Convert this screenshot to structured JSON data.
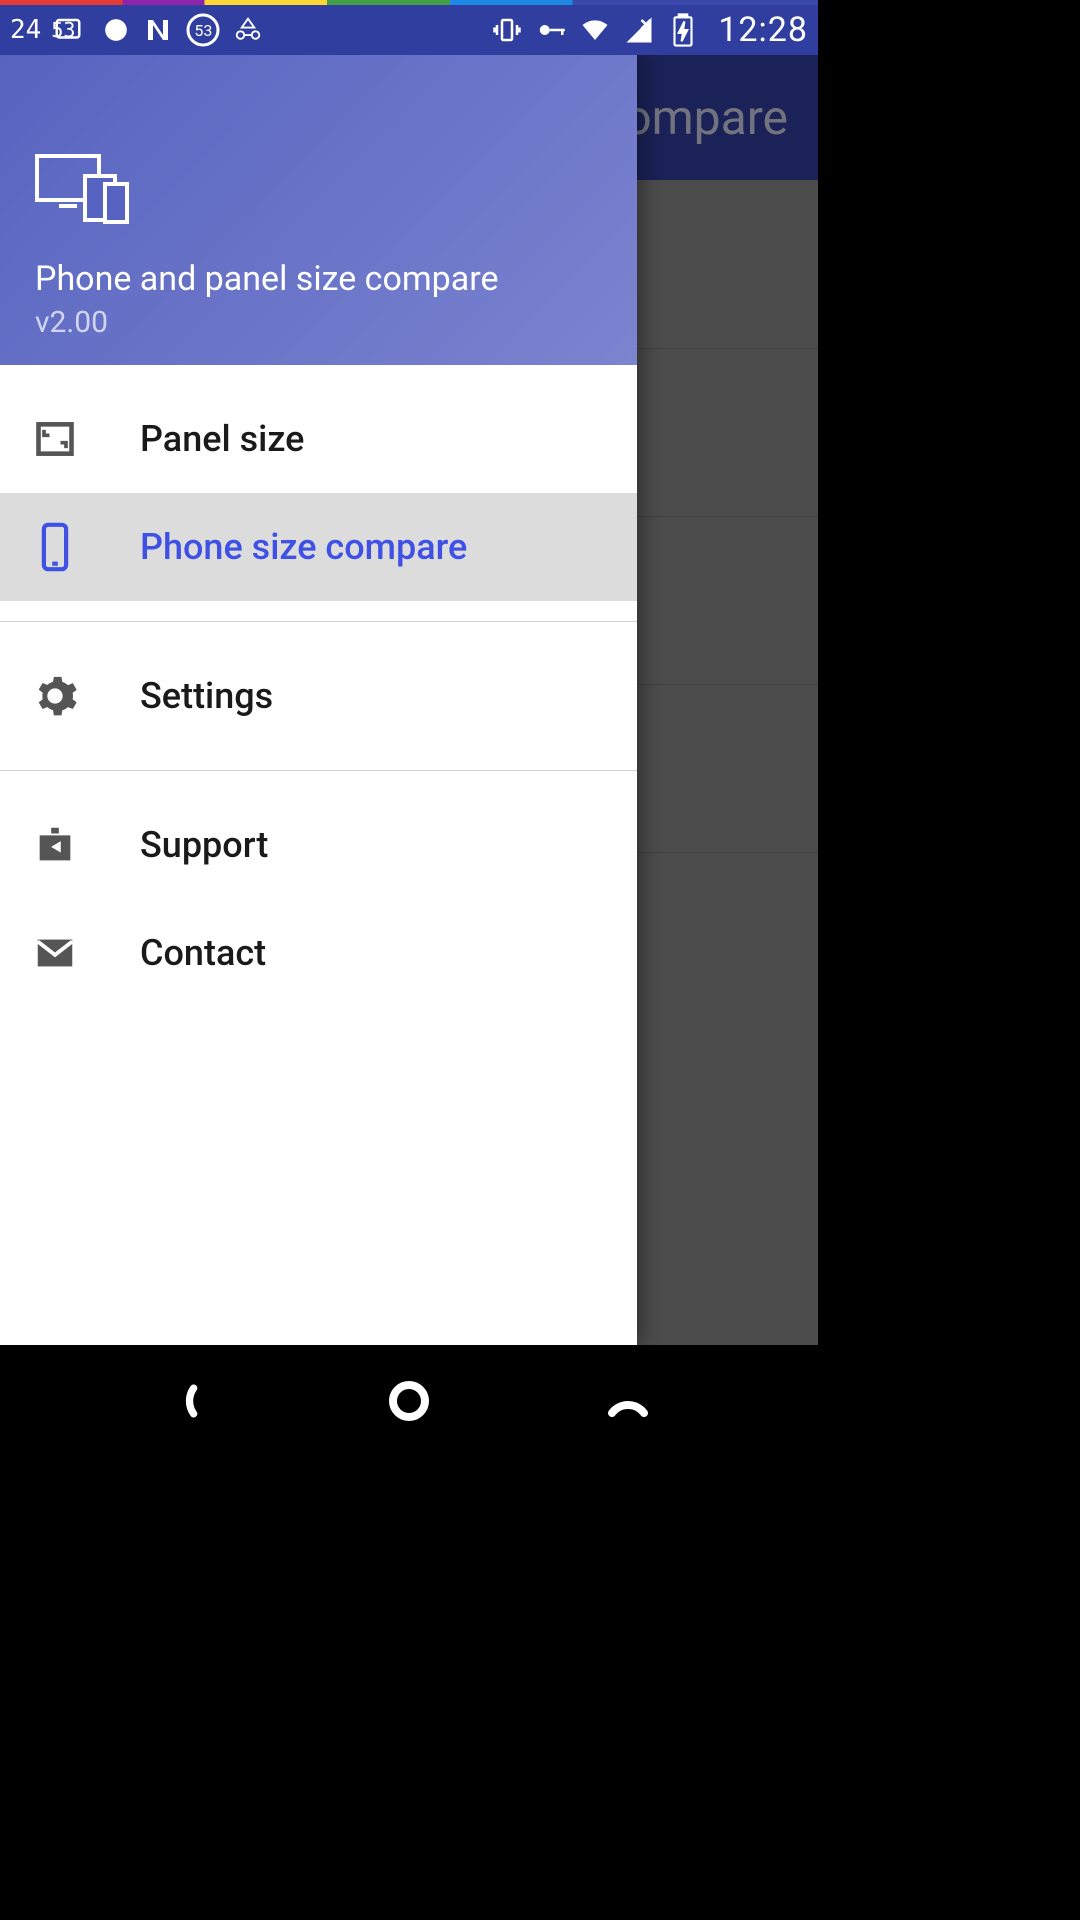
{
  "status": {
    "left_badges": [
      "24",
      "53"
    ],
    "circle_badge": "53",
    "time": "12:28"
  },
  "background": {
    "title_fragment": "ompare"
  },
  "drawer": {
    "title": "Phone and panel size compare",
    "version": "v2.00",
    "items": [
      {
        "label": "Panel size",
        "icon": "panel-size-icon",
        "selected": false
      },
      {
        "label": "Phone size compare",
        "icon": "phone-icon",
        "selected": true
      },
      {
        "label": "Settings",
        "icon": "gear-icon",
        "selected": false
      },
      {
        "label": "Support",
        "icon": "support-icon",
        "selected": false
      },
      {
        "label": "Contact",
        "icon": "mail-icon",
        "selected": false
      }
    ]
  }
}
